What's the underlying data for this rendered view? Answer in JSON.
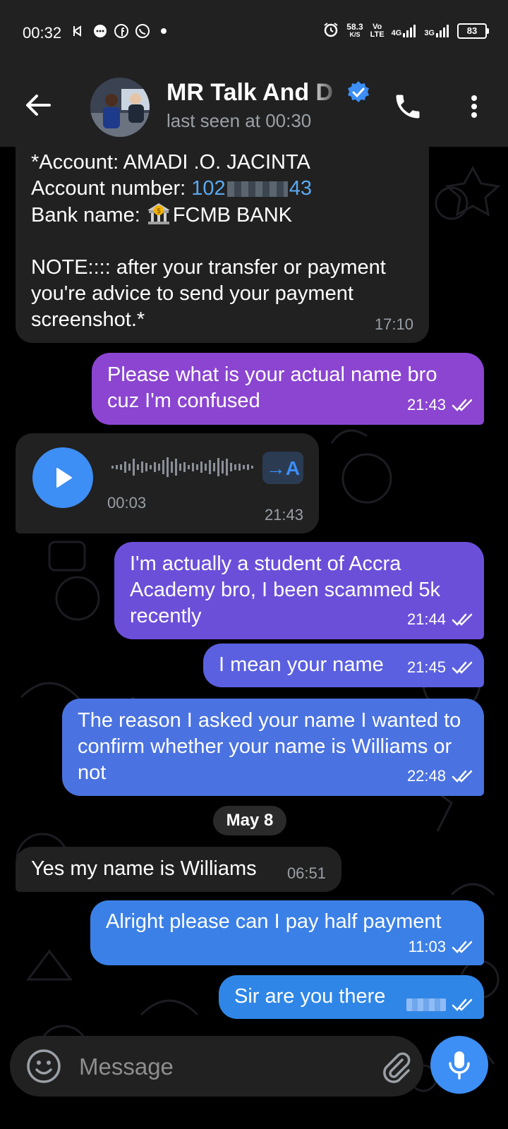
{
  "status_bar": {
    "time": "00:32",
    "net_speed_value": "58.3",
    "net_speed_unit": "K/S",
    "volte_top": "Vo",
    "volte_bottom": "LTE",
    "net1": "4G",
    "net2": "3G",
    "battery": "83"
  },
  "header": {
    "title": "MR Talk And D",
    "subtitle": "last seen at 00:30"
  },
  "messages": [
    {
      "id": "m1",
      "direction": "incoming",
      "account_line": "*Account: AMADI .O. JACINTA",
      "account_number_label": "Account number: ",
      "account_number_start": "102",
      "account_number_end": "43",
      "bank_label": "Bank name: ",
      "bank_name": "FCMB BANK",
      "note": "NOTE:::: after your transfer or payment you're advice to send your payment screenshot.*",
      "time": "17:10"
    },
    {
      "id": "m2",
      "direction": "outgoing",
      "text": "Please what is your actual name bro cuz I'm confused",
      "time": "21:43"
    },
    {
      "id": "m3",
      "direction": "incoming",
      "type": "voice",
      "duration": "00:03",
      "time": "21:43",
      "transcribe_label": "→A"
    },
    {
      "id": "m4",
      "direction": "outgoing",
      "text": "I'm actually a student of Accra Academy bro, I been scammed 5k recently",
      "time": "21:44"
    },
    {
      "id": "m5",
      "direction": "outgoing",
      "text": "I mean your name",
      "time": "21:45"
    },
    {
      "id": "m6",
      "direction": "outgoing",
      "text": "The reason I asked your name I wanted to confirm whether your name is Williams or not",
      "time": "22:48"
    },
    {
      "id": "m7",
      "direction": "incoming",
      "text": "Yes my name is Williams",
      "time": "06:51"
    },
    {
      "id": "m8",
      "direction": "outgoing",
      "text": "Alright please can I pay half payment",
      "time": "11:03"
    },
    {
      "id": "m9",
      "direction": "outgoing",
      "text": "Sir are you there",
      "time": ""
    }
  ],
  "date_separator": "May 8",
  "input": {
    "placeholder": "Message"
  },
  "icons": {
    "back": "back-arrow-icon",
    "verified": "verified-badge-icon",
    "call": "phone-icon",
    "menu": "more-vertical-icon",
    "emoji": "emoji-icon",
    "attach": "paperclip-icon",
    "mic": "microphone-icon",
    "play": "play-icon"
  },
  "colors": {
    "header_bg": "#212121",
    "incoming_bubble": "#212121",
    "outgoing_gradient_top": "#8a44d0",
    "outgoing_gradient_bottom": "#2f86e6",
    "accent": "#3d8ef5"
  }
}
